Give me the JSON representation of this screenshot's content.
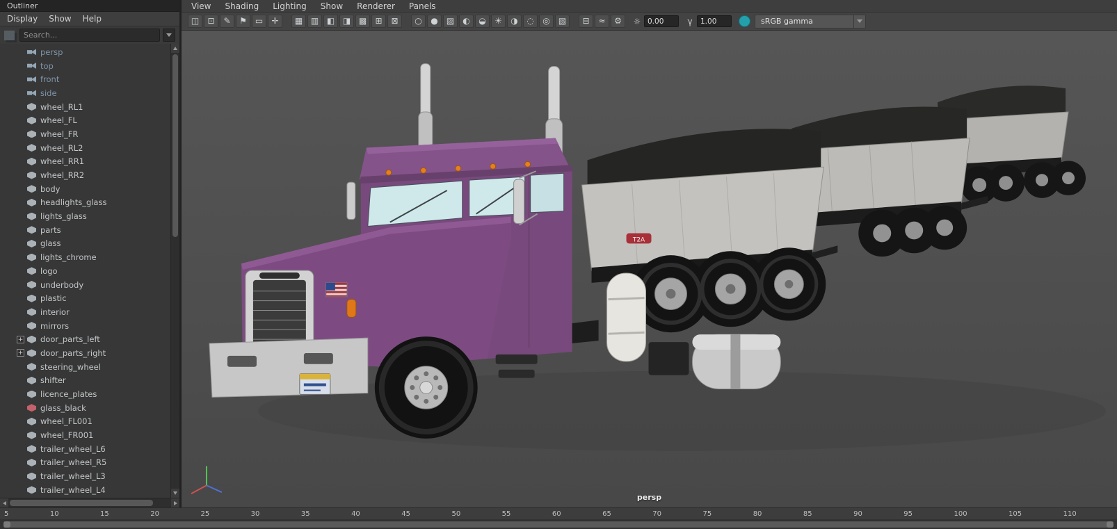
{
  "outliner": {
    "tab_title": "Outliner",
    "menu": [
      "Display",
      "Show",
      "Help"
    ],
    "search": {
      "placeholder": "Search..."
    },
    "expander_glyph": "+",
    "items": [
      {
        "label": "persp",
        "icon": "camera-icon"
      },
      {
        "label": "top",
        "icon": "camera-icon"
      },
      {
        "label": "front",
        "icon": "camera-icon"
      },
      {
        "label": "side",
        "icon": "camera-icon"
      },
      {
        "label": "wheel_RL1",
        "icon": "mesh-icon"
      },
      {
        "label": "wheel_FL",
        "icon": "mesh-icon"
      },
      {
        "label": "wheel_FR",
        "icon": "mesh-icon"
      },
      {
        "label": "wheel_RL2",
        "icon": "mesh-icon"
      },
      {
        "label": "wheel_RR1",
        "icon": "mesh-icon"
      },
      {
        "label": "wheel_RR2",
        "icon": "mesh-icon"
      },
      {
        "label": "body",
        "icon": "mesh-icon"
      },
      {
        "label": "headlights_glass",
        "icon": "mesh-icon"
      },
      {
        "label": "lights_glass",
        "icon": "mesh-icon"
      },
      {
        "label": "parts",
        "icon": "mesh-icon"
      },
      {
        "label": "glass",
        "icon": "mesh-icon"
      },
      {
        "label": "lights_chrome",
        "icon": "mesh-icon"
      },
      {
        "label": "logo",
        "icon": "mesh-icon"
      },
      {
        "label": "underbody",
        "icon": "mesh-icon"
      },
      {
        "label": "plastic",
        "icon": "mesh-icon"
      },
      {
        "label": "interior",
        "icon": "mesh-icon"
      },
      {
        "label": "mirrors",
        "icon": "mesh-icon"
      },
      {
        "label": "door_parts_left",
        "icon": "mesh-icon",
        "expandable": true
      },
      {
        "label": "door_parts_right",
        "icon": "mesh-icon",
        "expandable": true
      },
      {
        "label": "steering_wheel",
        "icon": "mesh-icon"
      },
      {
        "label": "shifter",
        "icon": "mesh-icon"
      },
      {
        "label": "licence_plates",
        "icon": "mesh-icon"
      },
      {
        "label": "glass_black",
        "icon": "mesh-red-icon"
      },
      {
        "label": "wheel_FL001",
        "icon": "mesh-icon"
      },
      {
        "label": "wheel_FR001",
        "icon": "mesh-icon"
      },
      {
        "label": "trailer_wheel_L6",
        "icon": "mesh-icon"
      },
      {
        "label": "trailer_wheel_R5",
        "icon": "mesh-icon"
      },
      {
        "label": "trailer_wheel_L3",
        "icon": "mesh-icon"
      },
      {
        "label": "trailer_wheel_L4",
        "icon": "mesh-icon"
      }
    ]
  },
  "viewport": {
    "menu": [
      "View",
      "Shading",
      "Lighting",
      "Show",
      "Renderer",
      "Panels"
    ],
    "toolbar": {
      "icons": [
        {
          "name": "select-camera-icon",
          "type": "icon",
          "glyph": "◫",
          "inter": "true"
        },
        {
          "name": "lock-camera-icon",
          "type": "icon",
          "glyph": "⊡",
          "inter": "true"
        },
        {
          "name": "camera-attributes-icon",
          "type": "icon",
          "glyph": "✎",
          "inter": "true"
        },
        {
          "name": "bookmark-icon",
          "type": "icon",
          "glyph": "⚑",
          "inter": "true"
        },
        {
          "name": "image-plane-icon",
          "type": "icon",
          "glyph": "▭",
          "inter": "true"
        },
        {
          "name": "pan-zoom-icon",
          "type": "icon",
          "glyph": "✛",
          "inter": "true"
        },
        {
          "name": "separator",
          "type": "sep",
          "glyph": "",
          "inter": "false"
        },
        {
          "name": "grid-icon",
          "type": "icon",
          "glyph": "▦",
          "inter": "true"
        },
        {
          "name": "film-gate-icon",
          "type": "icon",
          "glyph": "▥",
          "inter": "true"
        },
        {
          "name": "resolution-gate-icon",
          "type": "icon",
          "glyph": "◧",
          "inter": "true"
        },
        {
          "name": "gate-mask-icon",
          "type": "icon",
          "glyph": "◨",
          "inter": "true"
        },
        {
          "name": "field-chart-icon",
          "type": "icon",
          "glyph": "▩",
          "inter": "true"
        },
        {
          "name": "safe-action-icon",
          "type": "icon",
          "glyph": "⊞",
          "inter": "true"
        },
        {
          "name": "safe-title-icon",
          "type": "icon",
          "glyph": "⊠",
          "inter": "true"
        },
        {
          "name": "separator",
          "type": "sep",
          "glyph": "",
          "inter": "false"
        },
        {
          "name": "wireframe-icon",
          "type": "icon",
          "glyph": "○",
          "inter": "true"
        },
        {
          "name": "shaded-icon",
          "type": "icon",
          "glyph": "●",
          "inter": "true"
        },
        {
          "name": "textured-icon",
          "type": "icon",
          "glyph": "▨",
          "accent": "true",
          "inter": "true"
        },
        {
          "name": "default-material-icon",
          "type": "icon",
          "glyph": "◐",
          "inter": "true"
        },
        {
          "name": "xray-icon",
          "type": "icon",
          "glyph": "◒",
          "inter": "true"
        },
        {
          "name": "lighting-icon",
          "type": "icon",
          "glyph": "☀",
          "inter": "true"
        },
        {
          "name": "shadows-icon",
          "type": "icon",
          "glyph": "◑",
          "inter": "true"
        },
        {
          "name": "ao-icon",
          "type": "icon",
          "glyph": "◌",
          "accent": "true",
          "inter": "true"
        },
        {
          "name": "motion-blur-icon",
          "type": "icon",
          "glyph": "◎",
          "inter": "true"
        },
        {
          "name": "antialias-icon",
          "type": "icon",
          "glyph": "▧",
          "accent": "true",
          "inter": "true"
        },
        {
          "name": "separator",
          "type": "sep",
          "glyph": "",
          "inter": "false"
        },
        {
          "name": "isolate-select-icon",
          "type": "icon",
          "glyph": "⊟",
          "inter": "true"
        },
        {
          "name": "fog-icon",
          "type": "icon",
          "glyph": "≈",
          "inter": "true"
        },
        {
          "name": "gear-icon",
          "type": "icon",
          "glyph": "⚙",
          "inter": "true"
        }
      ],
      "exposure": {
        "glyph": "☼",
        "value": "0.00"
      },
      "gamma": {
        "glyph": "γ",
        "value": "1.00"
      },
      "colorspace": {
        "value": "sRGB gamma"
      }
    },
    "scene": {
      "trailer_logo": "T2A"
    },
    "camera_label": "persp"
  },
  "timeline": {
    "ticks": [
      "5",
      "10",
      "15",
      "20",
      "25",
      "30",
      "35",
      "40",
      "45",
      "50",
      "55",
      "60",
      "65",
      "70",
      "75",
      "80",
      "85",
      "90",
      "95",
      "100",
      "105",
      "110"
    ]
  },
  "colors": {
    "cab_paint": "#7d4b81",
    "trailer_body": "#c3c2be",
    "tarp": "#252523",
    "accent_marker": "#e5801e",
    "viewport_bg": "#4e4e4e"
  }
}
